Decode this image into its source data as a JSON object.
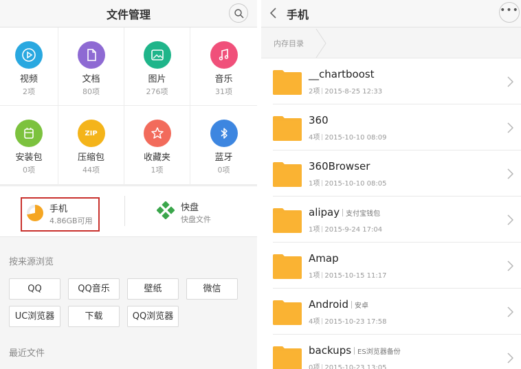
{
  "left": {
    "title": "文件管理",
    "categories": [
      {
        "label": "视频",
        "count": "2项",
        "color": "#29a8e0",
        "icon": "play-icon"
      },
      {
        "label": "文档",
        "count": "80项",
        "color": "#8e6ad3",
        "icon": "document-icon"
      },
      {
        "label": "图片",
        "count": "276项",
        "color": "#1fb58a",
        "icon": "image-icon"
      },
      {
        "label": "音乐",
        "count": "31项",
        "color": "#f0507a",
        "icon": "music-icon"
      },
      {
        "label": "安装包",
        "count": "0项",
        "color": "#7cc23e",
        "icon": "package-icon"
      },
      {
        "label": "压缩包",
        "count": "44项",
        "color": "#f4b41a",
        "icon": "zip-icon"
      },
      {
        "label": "收藏夹",
        "count": "1项",
        "color": "#f26b5b",
        "icon": "star-icon"
      },
      {
        "label": "蓝牙",
        "count": "0项",
        "color": "#3d86e0",
        "icon": "bluetooth-icon"
      }
    ],
    "zip_badge": "ZIP",
    "phone": {
      "name": "手机",
      "free": "4.86GB可用",
      "used_fraction": 0.72
    },
    "kuaipan": {
      "name": "快盘",
      "sub": "快盘文件"
    },
    "source_title": "按来源浏览",
    "sources": [
      "QQ",
      "QQ音乐",
      "壁纸",
      "微信",
      "UC浏览器",
      "下载",
      "QQ浏览器"
    ],
    "recent_title": "最近文件"
  },
  "right": {
    "title": "手机",
    "more": "•••",
    "breadcrumb": "内存目录",
    "folders": [
      {
        "name": "__chartboost",
        "tag": "",
        "count": "2项",
        "date": "2015-8-25 12:33"
      },
      {
        "name": "360",
        "tag": "",
        "count": "4项",
        "date": "2015-10-10 08:09"
      },
      {
        "name": "360Browser",
        "tag": "",
        "count": "1项",
        "date": "2015-10-10 08:05"
      },
      {
        "name": "alipay",
        "tag": "支付宝钱包",
        "count": "1项",
        "date": "2015-9-24 17:04"
      },
      {
        "name": "Amap",
        "tag": "",
        "count": "1项",
        "date": "2015-10-15 11:17"
      },
      {
        "name": "Android",
        "tag": "安卓",
        "count": "4项",
        "date": "2015-10-23 17:58"
      },
      {
        "name": "backups",
        "tag": "ES浏览器备份",
        "count": "0项",
        "date": "2015-10-23 13:05"
      }
    ]
  },
  "colors": {
    "folder": "#f9b233",
    "phone_highlight": "#c9302c",
    "kuaipan": "#3aa64b"
  }
}
